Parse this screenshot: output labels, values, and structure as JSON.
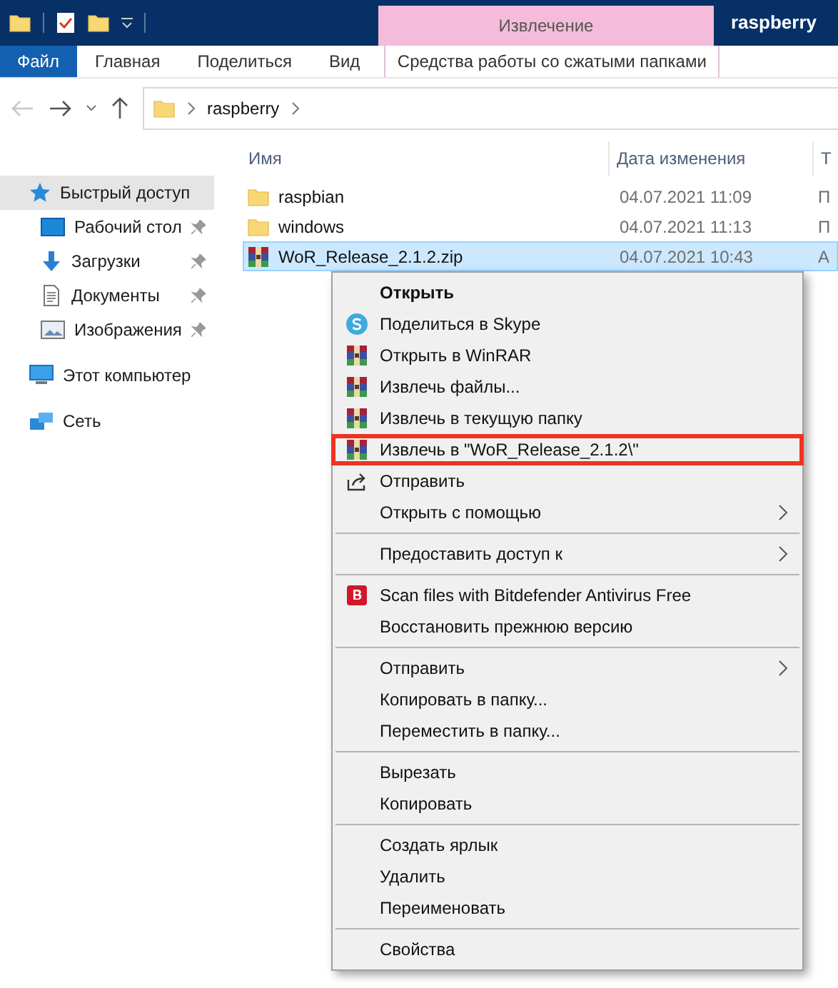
{
  "title_bar": {
    "contextual_tab": "Извлечение",
    "title": "raspberry"
  },
  "ribbon_tabs": [
    {
      "label": "Файл",
      "selected": true,
      "kind": "file"
    },
    {
      "label": "Главная",
      "selected": false,
      "kind": "tab"
    },
    {
      "label": "Поделиться",
      "selected": false,
      "kind": "tab"
    },
    {
      "label": "Вид",
      "selected": false,
      "kind": "tab"
    },
    {
      "label": "Средства работы со сжатыми папками",
      "selected": false,
      "kind": "contextual"
    }
  ],
  "address": {
    "path": "raspberry"
  },
  "sidebar": {
    "items": [
      {
        "label": "Быстрый доступ",
        "kind": "star",
        "selected": true,
        "pinned": false,
        "children": [
          {
            "label": "Рабочий стол",
            "kind": "desktop",
            "selected": false,
            "pinned": true
          },
          {
            "label": "Загрузки",
            "kind": "download",
            "selected": false,
            "pinned": true
          },
          {
            "label": "Документы",
            "kind": "document",
            "selected": false,
            "pinned": true
          },
          {
            "label": "Изображения",
            "kind": "image",
            "selected": false,
            "pinned": true
          }
        ]
      },
      {
        "label": "Этот компьютер",
        "kind": "computer",
        "selected": false,
        "pinned": false
      },
      {
        "label": "Сеть",
        "kind": "network",
        "selected": false,
        "pinned": false
      }
    ]
  },
  "table": {
    "columns": [
      "Имя",
      "Дата изменения",
      "Т"
    ],
    "rows": [
      {
        "name": "raspbian",
        "kind": "folder",
        "date": "04.07.2021 11:09",
        "column_3": "П",
        "selected": false
      },
      {
        "name": "windows",
        "kind": "folder",
        "date": "04.07.2021 11:13",
        "column_3": "П",
        "selected": false
      },
      {
        "name": "WoR_Release_2.1.2.zip",
        "kind": "archive",
        "date": "04.07.2021 10:43",
        "column_3": "А",
        "selected": true
      }
    ]
  },
  "context_menu": [
    {
      "kind": "plain",
      "label": "Открыть",
      "bold": true,
      "submenu": false,
      "highlighted": false
    },
    {
      "kind": "skype",
      "label": "Поделиться в Skype",
      "bold": false,
      "submenu": false,
      "highlighted": false
    },
    {
      "kind": "winrar",
      "label": "Открыть в WinRAR",
      "bold": false,
      "submenu": false,
      "highlighted": false
    },
    {
      "kind": "winrar",
      "label": "Извлечь файлы...",
      "bold": false,
      "submenu": false,
      "highlighted": false
    },
    {
      "kind": "winrar",
      "label": "Извлечь в текущую папку",
      "bold": false,
      "submenu": false,
      "highlighted": false
    },
    {
      "kind": "winrar",
      "label": "Извлечь в \"WoR_Release_2.1.2\\\"",
      "bold": false,
      "submenu": false,
      "highlighted": true
    },
    {
      "kind": "share",
      "label": "Отправить",
      "bold": false,
      "submenu": false,
      "highlighted": false
    },
    {
      "kind": "plain",
      "label": "Открыть с помощью",
      "bold": false,
      "submenu": true,
      "highlighted": false
    },
    {
      "kind": "separator"
    },
    {
      "kind": "plain",
      "label": "Предоставить доступ к",
      "bold": false,
      "submenu": true,
      "highlighted": false
    },
    {
      "kind": "separator"
    },
    {
      "kind": "bitdefender",
      "label": "Scan files with Bitdefender Antivirus Free",
      "bold": false,
      "submenu": false,
      "highlighted": false
    },
    {
      "kind": "plain",
      "label": "Восстановить прежнюю версию",
      "bold": false,
      "submenu": false,
      "highlighted": false
    },
    {
      "kind": "separator"
    },
    {
      "kind": "plain",
      "label": "Отправить",
      "bold": false,
      "submenu": true,
      "highlighted": false
    },
    {
      "kind": "plain",
      "label": "Копировать в папку...",
      "bold": false,
      "submenu": false,
      "highlighted": false
    },
    {
      "kind": "plain",
      "label": "Переместить в папку...",
      "bold": false,
      "submenu": false,
      "highlighted": false
    },
    {
      "kind": "separator"
    },
    {
      "kind": "plain",
      "label": "Вырезать",
      "bold": false,
      "submenu": false,
      "highlighted": false
    },
    {
      "kind": "plain",
      "label": "Копировать",
      "bold": false,
      "submenu": false,
      "highlighted": false
    },
    {
      "kind": "separator"
    },
    {
      "kind": "plain",
      "label": "Создать ярлык",
      "bold": false,
      "submenu": false,
      "highlighted": false
    },
    {
      "kind": "plain",
      "label": "Удалить",
      "bold": false,
      "submenu": false,
      "highlighted": false
    },
    {
      "kind": "plain",
      "label": "Переименовать",
      "bold": false,
      "submenu": false,
      "highlighted": false
    },
    {
      "kind": "separator"
    },
    {
      "kind": "plain",
      "label": "Свойства",
      "bold": false,
      "submenu": false,
      "highlighted": false
    }
  ]
}
